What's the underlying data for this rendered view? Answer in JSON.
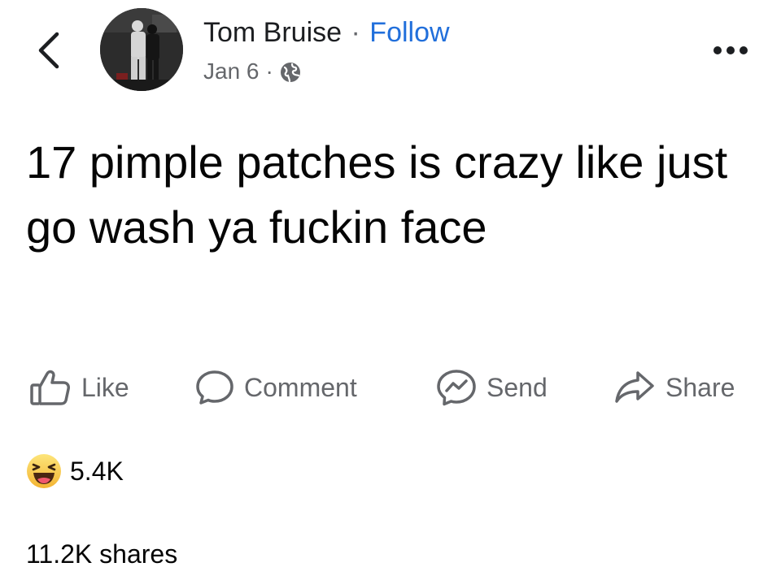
{
  "header": {
    "author_name": "Tom Bruise",
    "separator": "·",
    "follow_label": "Follow",
    "date": "Jan 6",
    "meta_separator": "·",
    "audience_icon": "globe-icon",
    "back_icon": "chevron-left-icon",
    "more_icon": "more-horizontal-icon"
  },
  "post": {
    "text": "17 pimple patches is crazy like just go wash ya fuckin face"
  },
  "actions": [
    {
      "label": "Like",
      "icon": "thumbs-up-icon"
    },
    {
      "label": "Comment",
      "icon": "comment-icon"
    },
    {
      "label": "Send",
      "icon": "messenger-icon"
    },
    {
      "label": "Share",
      "icon": "share-icon"
    }
  ],
  "reactions": {
    "icon": "haha-emoji-icon",
    "count": "5.4K"
  },
  "shares": {
    "text": "11.2K shares"
  },
  "colors": {
    "link_blue": "#216fdb",
    "secondary_text": "#65676b",
    "primary_text": "#050505",
    "reaction_yellow": "#f7c74a"
  }
}
